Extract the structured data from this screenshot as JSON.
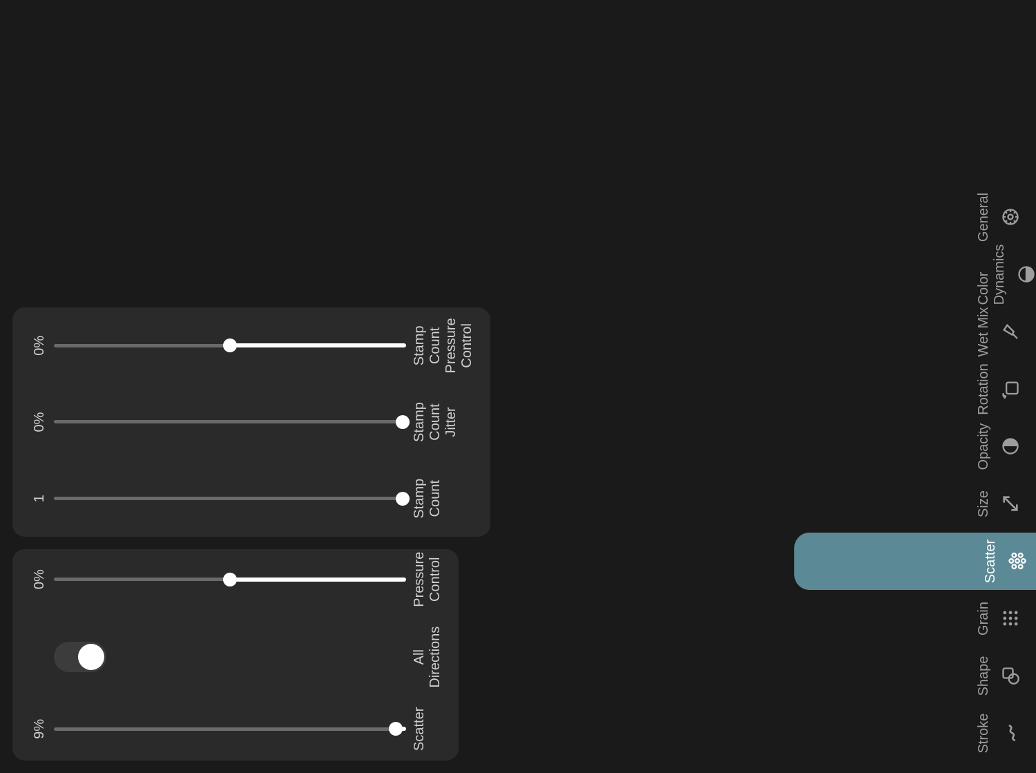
{
  "accent": "#5b8a96",
  "panels": {
    "a": {
      "scatter": {
        "label": "Scatter",
        "value": "9%",
        "fill_pct": 3
      },
      "all_directions": {
        "label": "All Directions",
        "enabled": true
      },
      "pressure": {
        "label": "Pressure Control",
        "value": "0%",
        "fill_pct": 50
      }
    },
    "b": {
      "stamp_count": {
        "label": "Stamp Count",
        "value": "1",
        "fill_pct": 1
      },
      "stamp_count_jitter": {
        "label": "Stamp Count Jitter",
        "value": "0%",
        "fill_pct": 1
      },
      "stamp_count_press": {
        "label": "Stamp Count Pressure Control",
        "value": "0%",
        "fill_pct": 50
      }
    }
  },
  "nav": {
    "active": "scatter",
    "items": [
      {
        "id": "stroke",
        "label": "Stroke"
      },
      {
        "id": "shape",
        "label": "Shape"
      },
      {
        "id": "grain",
        "label": "Grain"
      },
      {
        "id": "scatter",
        "label": "Scatter"
      },
      {
        "id": "size",
        "label": "Size"
      },
      {
        "id": "opacity",
        "label": "Opacity"
      },
      {
        "id": "rotation",
        "label": "Rotation"
      },
      {
        "id": "wetmix",
        "label": "Wet Mix"
      },
      {
        "id": "colordyn",
        "label": "Color Dynamics"
      },
      {
        "id": "general",
        "label": "General"
      }
    ]
  }
}
